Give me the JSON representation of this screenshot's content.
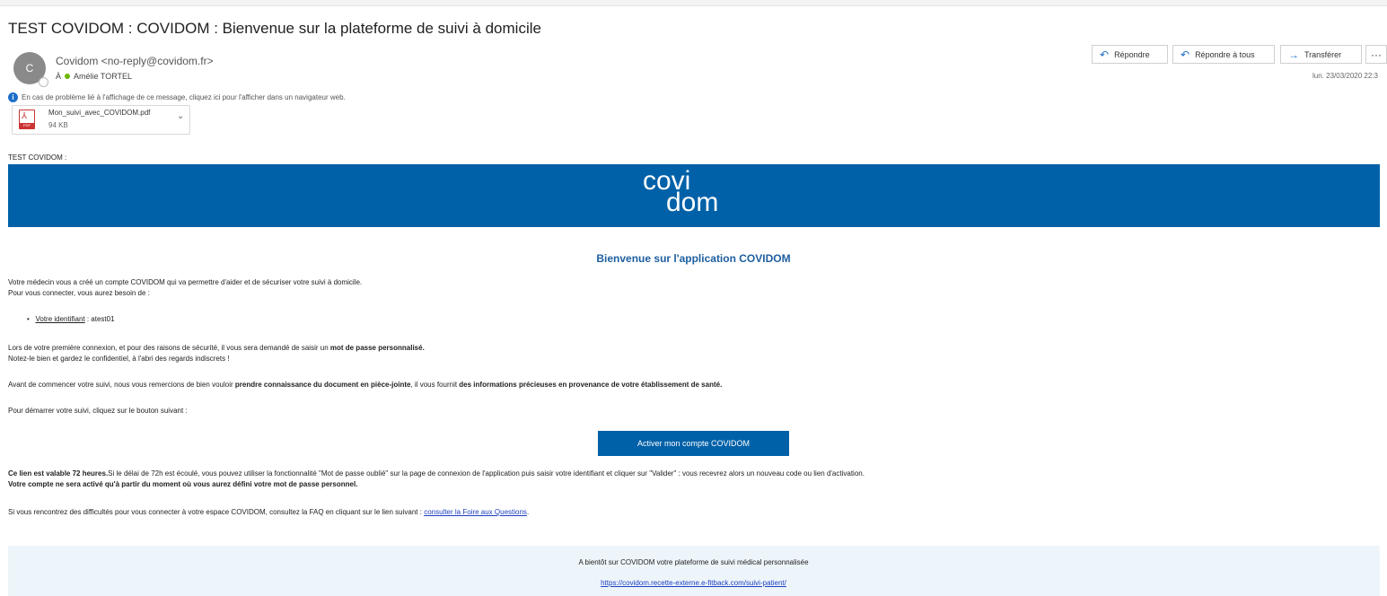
{
  "email": {
    "subject": "TEST COVIDOM : COVIDOM : Bienvenue sur la plateforme de suivi à domicile",
    "avatar_initial": "C",
    "sender": "Covidom <no-reply@covidom.fr>",
    "to_label": "À",
    "recipient": "Amélie TORTEL",
    "info_notice": "En cas de problème lié à l'affichage de ce message, cliquez ici pour l'afficher dans un navigateur web.",
    "date": "lun. 23/03/2020 22:3"
  },
  "attachment": {
    "name": "Mon_suivi_avec_COVIDOM.pdf",
    "size": "94 KB",
    "icon": "pdf-file-icon"
  },
  "toolbar": {
    "reply": "Répondre",
    "reply_all": "Répondre à tous",
    "forward": "Transférer",
    "more": "···"
  },
  "body": {
    "greeting": "TEST COVIDOM :",
    "logo_line1": "covi",
    "logo_line2": "dom",
    "welcome": "Bienvenue sur l'application COVIDOM",
    "intro1": "Votre médecin vous a créé un compte COVIDOM qui va permettre d'aider et de sécuriser votre suivi à domicile.",
    "intro2": "Pour vous connecter, vous aurez besoin de :",
    "identifier_label": "Votre identifiant",
    "identifier_value": " : atest01",
    "pw_text1": "Lors de votre première connexion, et pour des raisons de sécurité, il vous sera demandé de saisir un ",
    "pw_bold": "mot de passe personnalisé.",
    "pw_text2": "Notez-le bien et gardez le confidentiel, à l'abri des regards indiscrets !",
    "doc_text1": "Avant de commencer votre suivi, nous vous remercions de bien vouloir ",
    "doc_bold1": "prendre connaissance du document en pièce-jointe",
    "doc_text2": ", il vous fournit ",
    "doc_bold2": "des informations précieuses en provenance de votre établissement de santé.",
    "start_text": "Pour démarrer votre suivi, cliquez sur le bouton suivant :",
    "cta": "Activer mon compte COVIDOM",
    "validity_bold": "Ce lien est valable 72 heures.",
    "validity_text": "Si le délai de 72h est écoulé, vous pouvez utiliser la fonctionnalité \"Mot de passe oublié\" sur la page de connexion de l'application puis saisir votre identifiant et cliquer sur \"Valider\" : vous recevrez alors un nouveau code ou lien d'activation.",
    "activation_bold": "Votre compte ne sera activé qu'à partir du moment où vous aurez défini votre mot de passe personnel.",
    "faq_text": "Si vous rencontrez des difficultés pour vous connecter à votre espace COVIDOM, consultez la FAQ en cliquant sur le lien suivant : ",
    "faq_link": "consulter la Foire aux Questions",
    "faq_end": "."
  },
  "footer": {
    "tagline": "A bientôt sur COVIDOM votre plateforme de suivi médical personnalisée",
    "url": "https://covidom.recette-externe.e-fitback.com/suivi-patient/"
  },
  "colors": {
    "brand_blue": "#0061a8",
    "heading_blue": "#1e5fa0",
    "link_blue": "#1c3fc0",
    "footer_bg": "#eef5fa"
  }
}
